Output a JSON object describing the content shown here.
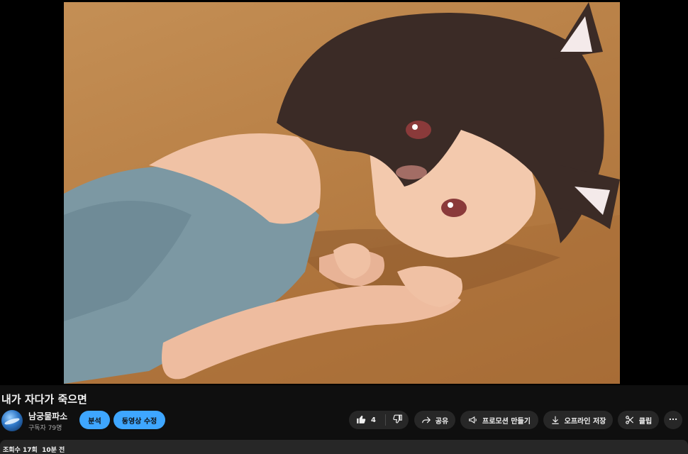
{
  "video": {
    "title": "내가 자다가 죽으면",
    "thumbnail_description_icon": "anime-girl-illustration"
  },
  "channel": {
    "name": "남궁물파소",
    "subscribers": "구독자 79명"
  },
  "owner_actions": {
    "analytics_label": "분석",
    "edit_video_label": "동영상 수정"
  },
  "actions": {
    "like_count": "4",
    "share_label": "공유",
    "promote_label": "프로모션 만들기",
    "offline_save_label": "오프라인 저장",
    "clip_label": "클립"
  },
  "description": {
    "views": "조회수 17회",
    "time": "10분 전"
  },
  "colors": {
    "background": "#0f0f0f",
    "button": "#272727",
    "accent": "#3ea6ff"
  }
}
